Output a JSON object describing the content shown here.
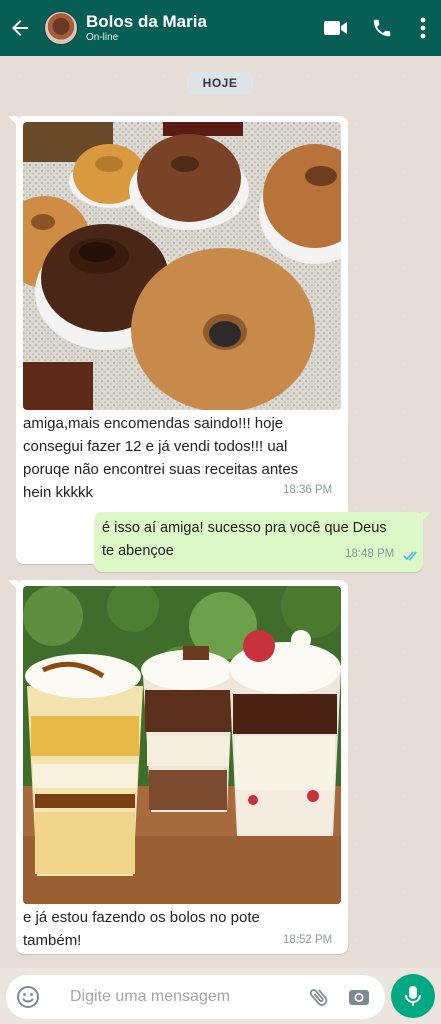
{
  "header": {
    "contact_name": "Bolos da Maria",
    "contact_status": "On-line",
    "background_color": "#075e54",
    "icons": [
      "back-arrow-icon",
      "video-call-icon",
      "phone-icon",
      "more-vert-icon"
    ]
  },
  "chat": {
    "day_label": "HOJE",
    "messages": [
      {
        "direction": "incoming",
        "image": "photo of assorted ring-shaped bundt cakes, some chocolate-glazed, on a granite counter",
        "text": "amiga,mais encomendas saindo!!! hoje consegui fazer 12 e já vendi todos!!! ual poruqe não encontrei suas receitas antes hein kkkkk",
        "lines": [
          "amiga,mais encomendas saindo!!! hoje",
          "consegui fazer 12 e já vendi todos!!! ual",
          "poruqe não encontrei suas receitas antes",
          "hein kkkkk"
        ],
        "time": "18:36 PM"
      },
      {
        "direction": "outgoing",
        "text": "é isso aí amiga! sucesso pra você que Deus te abençoe",
        "lines": [
          "é isso aí amiga! sucesso pra você que Deus",
          "te abençoe"
        ],
        "time": "18:48 PM",
        "status": "read"
      },
      {
        "direction": "incoming",
        "image": "photo of three layered dessert cups with whipped cream, chocolate and strawberry",
        "text": "e já estou fazendo os bolos no pote também!",
        "lines": [
          "e já estou fazendo os bolos no pote",
          "também!"
        ],
        "time": "18:52 PM"
      }
    ]
  },
  "composer": {
    "placeholder": "Digite uma mensagem",
    "icons": [
      "emoji-icon",
      "attach-icon",
      "camera-icon",
      "mic-icon"
    ],
    "mic_color": "#00a884"
  }
}
